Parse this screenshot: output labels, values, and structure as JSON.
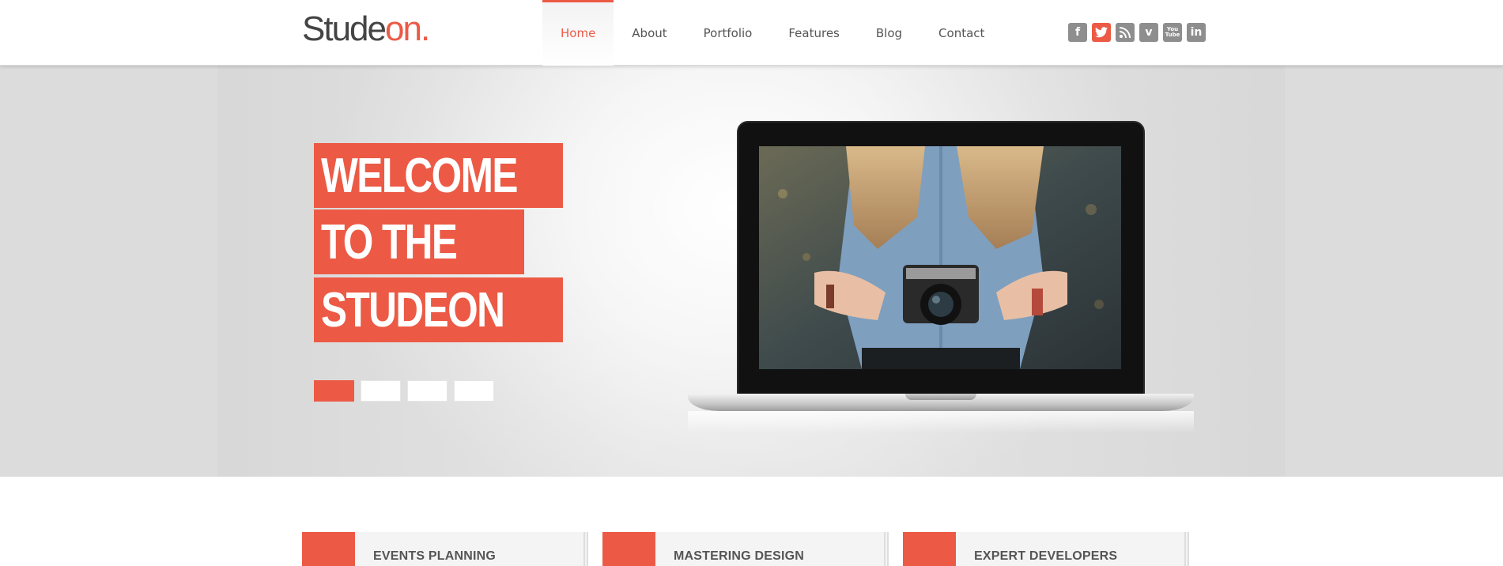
{
  "header": {
    "logo_main": "Stude",
    "logo_accent": "on",
    "logo_dot": ".",
    "nav": [
      {
        "label": "Home",
        "active": true
      },
      {
        "label": "About"
      },
      {
        "label": "Portfolio"
      },
      {
        "label": "Features"
      },
      {
        "label": "Blog"
      },
      {
        "label": "Contact"
      }
    ],
    "social_icons": [
      "facebook-icon",
      "twitter-icon",
      "rss-icon",
      "vimeo-icon",
      "youtube-icon",
      "linkedin-icon"
    ],
    "social_glyphs": {
      "facebook": "f",
      "twitter": "t",
      "rss": "))",
      "vimeo": "v",
      "youtube_top": "You",
      "youtube_bottom": "Tube",
      "linkedin": "in"
    }
  },
  "hero": {
    "headline_lines": [
      "WELCOME",
      "TO THE",
      "STUDEON"
    ],
    "slider_count": 4,
    "active_slide": 1
  },
  "features": [
    {
      "title": "EVENTS PLANNING"
    },
    {
      "title": "MASTERING DESIGN"
    },
    {
      "title": "EXPERT DEVELOPERS"
    }
  ],
  "colors": {
    "accent": "#ec5a45",
    "text": "#555555",
    "icon_gray": "#8e8e8e"
  }
}
